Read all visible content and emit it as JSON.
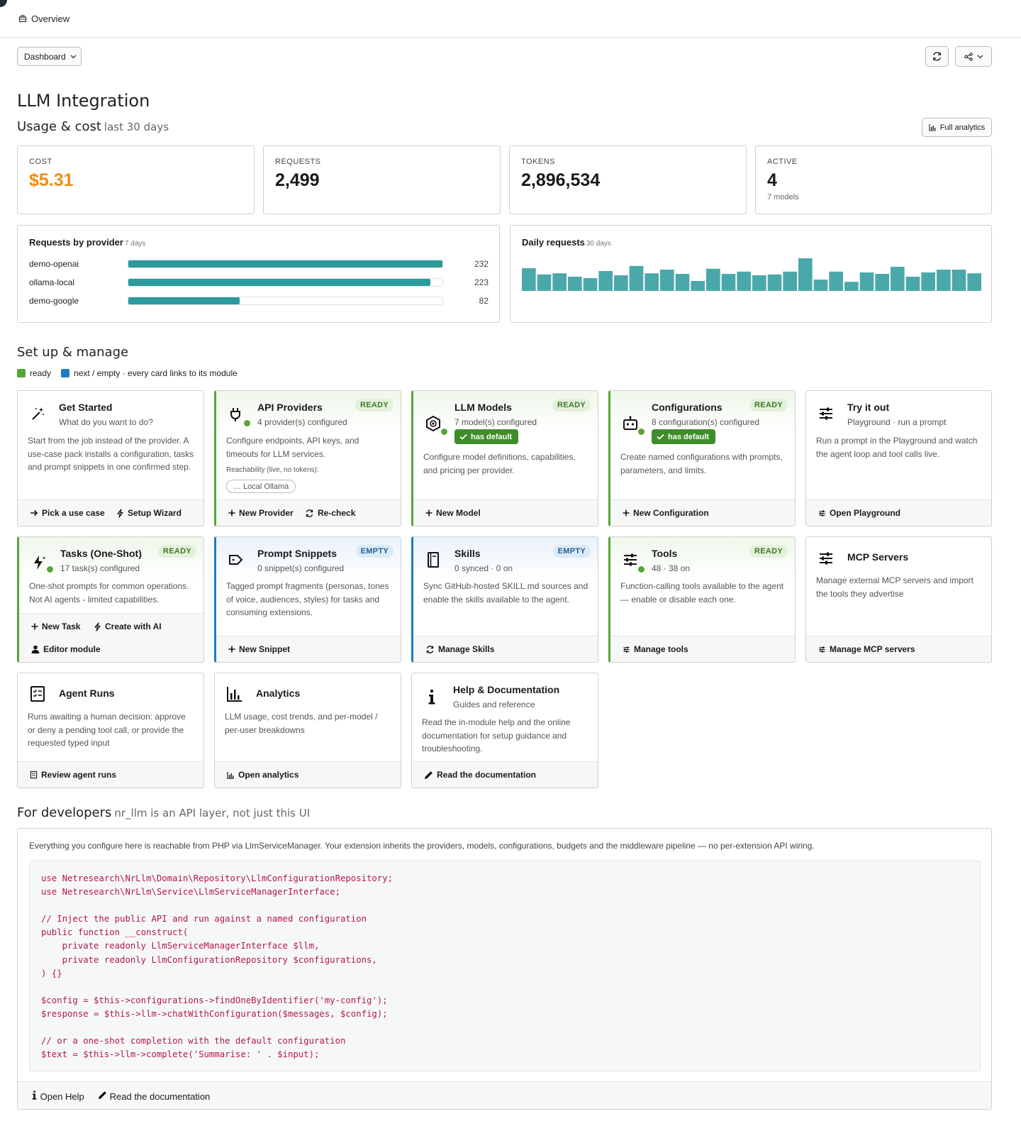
{
  "topbar": {
    "label": "Overview"
  },
  "toolbar": {
    "dashboard_select": "Dashboard"
  },
  "page_title": "LLM Integration",
  "usage": {
    "heading": "Usage & cost",
    "period": "last 30 days",
    "full_analytics": "Full analytics",
    "stats": {
      "cost": {
        "label": "COST",
        "value": "$5.31"
      },
      "requests": {
        "label": "REQUESTS",
        "value": "2,499"
      },
      "tokens": {
        "label": "TOKENS",
        "value": "2,896,534"
      },
      "active": {
        "label": "ACTIVE",
        "value": "4",
        "sub": "7 models"
      }
    }
  },
  "providers_panel": {
    "title": "Requests by provider",
    "period": "7 days",
    "max": 232,
    "rows": [
      {
        "name": "demo-openai",
        "value": 232
      },
      {
        "name": "ollama-local",
        "value": 223
      },
      {
        "name": "demo-google",
        "value": 82
      }
    ]
  },
  "daily_panel": {
    "title": "Daily requests",
    "period": "30 days"
  },
  "chart_data": {
    "type": "bar",
    "title": "Daily requests",
    "values": [
      80,
      58,
      62,
      50,
      45,
      70,
      55,
      88,
      62,
      75,
      60,
      35,
      78,
      60,
      68,
      55,
      58,
      68,
      115,
      40,
      68,
      32,
      65,
      60,
      85,
      50,
      65,
      75,
      75,
      62
    ]
  },
  "setup": {
    "heading": "Set up & manage",
    "legend_ready": "ready",
    "legend_next": "next / empty · every card links to its module",
    "colors": {
      "ready": "#56a637",
      "empty": "#1f7bc1"
    },
    "cards": {
      "get_started": {
        "title": "Get Started",
        "sub": "What do you want to do?",
        "desc": "Start from the job instead of the provider. A use-case pack installs a configuration, tasks and prompt snippets in one confirmed step.",
        "link1": "Pick a use case",
        "link2": "Setup Wizard",
        "icon": "magic-wand-icon"
      },
      "api_providers": {
        "title": "API Providers",
        "badge": "READY",
        "sub": "4 provider(s) configured",
        "desc": "Configure endpoints, API keys, and timeouts for LLM services.",
        "reach": "Reachability (live, no tokens):",
        "chip": "… Local Ollama",
        "link1": "New Provider",
        "link2": "Re-check",
        "icon": "plug-icon"
      },
      "llm_models": {
        "title": "LLM Models",
        "badge": "READY",
        "sub": "7 model(s) configured",
        "has_default": "has default",
        "desc": "Configure model definitions, capabilities, and pricing per provider.",
        "link1": "New Model",
        "icon": "hexagon-chip-icon"
      },
      "configurations": {
        "title": "Configurations",
        "badge": "READY",
        "sub": "8 configuration(s) configured",
        "has_default": "has default",
        "desc": "Create named configurations with prompts, parameters, and limits.",
        "link1": "New Configuration",
        "icon": "robot-icon"
      },
      "try_it_out": {
        "title": "Try it out",
        "sub": "Playground · run a prompt",
        "desc": "Run a prompt in the Playground and watch the agent loop and tool calls live.",
        "link1": "Open Playground",
        "icon": "sliders-icon"
      },
      "tasks": {
        "title": "Tasks (One-Shot)",
        "badge": "READY",
        "sub": "17 task(s) configured",
        "desc": "One-shot prompts for common operations. Not AI agents - limited capabilities.",
        "link1": "New Task",
        "link2": "Create with AI",
        "link3": "Editor module",
        "icon": "bolt-sparkle-icon"
      },
      "prompt_snippets": {
        "title": "Prompt Snippets",
        "badge": "EMPTY",
        "sub": "0 snippet(s) configured",
        "desc": "Tagged prompt fragments (personas, tones of voice, audiences, styles) for tasks and consuming extensions.",
        "link1": "New Snippet",
        "icon": "tag-icon"
      },
      "skills": {
        "title": "Skills",
        "badge": "EMPTY",
        "sub": "0 synced · 0 on",
        "desc": "Sync GitHub-hosted SKILL.md sources and enable the skills available to the agent.",
        "link1": "Manage Skills",
        "icon": "book-icon"
      },
      "tools": {
        "title": "Tools",
        "badge": "READY",
        "sub": "48 · 38 on",
        "desc": "Function-calling tools available to the agent — enable or disable each one.",
        "link1": "Manage tools",
        "icon": "sliders-icon"
      },
      "mcp": {
        "title": "MCP Servers",
        "desc": "Manage external MCP servers and import the tools they advertise",
        "link1": "Manage MCP servers",
        "icon": "sliders-icon"
      },
      "agent_runs": {
        "title": "Agent Runs",
        "desc": "Runs awaiting a human decision: approve or deny a pending tool call, or provide the requested typed input",
        "link1": "Review agent runs",
        "icon": "checklist-icon"
      },
      "analytics": {
        "title": "Analytics",
        "desc": "LLM usage, cost trends, and per-model / per-user breakdowns",
        "link1": "Open analytics",
        "icon": "bar-chart-icon"
      },
      "help": {
        "title": "Help & Documentation",
        "sub": "Guides and reference",
        "desc": "Read the in-module help and the online documentation for setup guidance and troubleshooting.",
        "link1": "Read the documentation",
        "icon": "info-icon"
      }
    }
  },
  "developers": {
    "heading": "For developers",
    "sub": "nr_llm is an API layer, not just this UI",
    "intro": "Everything you configure here is reachable from PHP via LlmServiceManager. Your extension inherits the providers, models, configurations, budgets and the middleware pipeline — no per-extension API wiring.",
    "code": "use Netresearch\\NrLlm\\Domain\\Repository\\LlmConfigurationRepository;\nuse Netresearch\\NrLlm\\Service\\LlmServiceManagerInterface;\n\n// Inject the public API and run against a named configuration\npublic function __construct(\n    private readonly LlmServiceManagerInterface $llm,\n    private readonly LlmConfigurationRepository $configurations,\n) {}\n\n$config = $this->configurations->findOneByIdentifier('my-config');\n$response = $this->llm->chatWithConfiguration($messages, $config);\n\n// or a one-shot completion with the default configuration\n$text = $this->llm->complete('Summarise: ' . $input);",
    "open_help": "Open Help",
    "read_docs": "Read the documentation"
  }
}
